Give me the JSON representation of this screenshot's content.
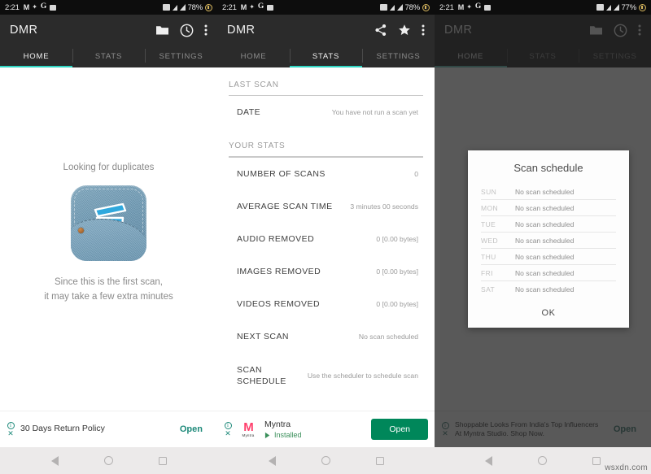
{
  "statusbar": {
    "time": "2:21",
    "left_icons": [
      "gmail-icon",
      "sync-icon",
      "google-icon",
      "image-icon"
    ],
    "right_icons": [
      "screenshot-icon",
      "signal-icon-1",
      "signal-icon-2"
    ],
    "battery_p1": "78%",
    "battery_p2": "78%",
    "battery_p3": "77%"
  },
  "appbar": {
    "title": "DMR",
    "p1_icons": [
      "folder-icon",
      "clock-icon",
      "overflow-menu-icon"
    ],
    "p2_icons": [
      "share-icon",
      "star-icon",
      "overflow-menu-icon"
    ],
    "p3_icons": [
      "folder-icon",
      "clock-icon",
      "overflow-menu-icon"
    ]
  },
  "tabs": {
    "items": [
      {
        "label": "HOME"
      },
      {
        "label": "STATS"
      },
      {
        "label": "SETTINGS"
      }
    ],
    "active_p1": 0,
    "active_p2": 1,
    "active_p3": 0,
    "accent_color": "#2fd6c3"
  },
  "home": {
    "looking_text": "Looking for duplicates",
    "app_icon_name": "denim-pocket-trash-icon",
    "since_line1": "Since this is the first scan,",
    "since_line2": "it may take a few extra minutes"
  },
  "stats": {
    "section_last_scan": "LAST SCAN",
    "section_your_stats": "YOUR STATS",
    "last_scan_rows": [
      {
        "key": "DATE",
        "value": "You have not run a scan yet"
      }
    ],
    "your_stats_rows": [
      {
        "key": "NUMBER OF SCANS",
        "value": "0"
      },
      {
        "key": "AVERAGE SCAN TIME",
        "value": "3 minutes 00 seconds"
      },
      {
        "key": "AUDIO REMOVED",
        "value": "0 [0.00 bytes]"
      },
      {
        "key": "IMAGES REMOVED",
        "value": "0 [0.00 bytes]"
      },
      {
        "key": "VIDEOS REMOVED",
        "value": "0 [0.00 bytes]"
      },
      {
        "key": "NEXT SCAN",
        "value": "No scan scheduled"
      },
      {
        "key": "SCAN SCHEDULE",
        "value": "Use the scheduler to schedule scan"
      }
    ]
  },
  "dialog": {
    "title": "Scan schedule",
    "rows": [
      {
        "day": "SUN",
        "value": "No scan scheduled"
      },
      {
        "day": "MON",
        "value": "No scan scheduled"
      },
      {
        "day": "TUE",
        "value": "No scan scheduled"
      },
      {
        "day": "WED",
        "value": "No scan scheduled"
      },
      {
        "day": "THU",
        "value": "No scan scheduled"
      },
      {
        "day": "FRI",
        "value": "No scan scheduled"
      },
      {
        "day": "SAT",
        "value": "No scan scheduled"
      }
    ],
    "ok_label": "OK"
  },
  "ads": {
    "p1": {
      "text": "30 Days Return Policy",
      "cta": "Open",
      "info_icon": "info-icon",
      "close_icon": "close-icon"
    },
    "p2": {
      "brand": "Myntra",
      "brand_word": "Myntra",
      "brand_letter": "M",
      "installed": "Installed",
      "cta": "Open",
      "info_icon": "info-icon",
      "close_icon": "close-icon",
      "brand_color": "#ff3f6c"
    },
    "p3": {
      "text": "Shoppable Looks From India's Top Influencers At Myntra Studio. Shop Now.",
      "cta": "Open",
      "info_icon": "info-icon",
      "close_icon": "close-icon"
    }
  },
  "navbar": {
    "back": "back-icon",
    "home": "home-icon",
    "recents": "recents-icon"
  },
  "watermark": "wsxdn.com"
}
